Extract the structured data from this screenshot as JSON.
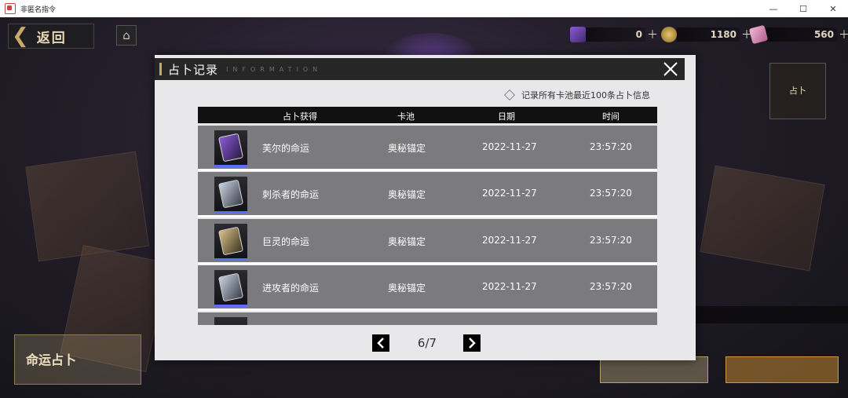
{
  "window": {
    "title": "非匿名指令"
  },
  "topbar": {
    "back_label": "返回",
    "resources": [
      {
        "icon": "purple-gem-icon",
        "value": "0"
      },
      {
        "icon": "gold-coin-icon",
        "value": "1180"
      },
      {
        "icon": "pink-ticket-icon",
        "value": "560"
      }
    ]
  },
  "modal": {
    "title": "占卜记录",
    "subtitle": "INFORMATION",
    "note": "记录所有卡池最近100条占卜信息",
    "columns": [
      "占卜获得",
      "卡池",
      "日期",
      "时间"
    ],
    "rows": [
      {
        "item": "芙尔的命运",
        "pool": "奥秘锚定",
        "date": "2022-11-27",
        "time": "23:57:20",
        "card_color": "#8a5bd6"
      },
      {
        "item": "刺杀者的命运",
        "pool": "奥秘锚定",
        "date": "2022-11-27",
        "time": "23:57:20",
        "card_color": "#9aa5b8"
      },
      {
        "item": "巨灵的命运",
        "pool": "奥秘锚定",
        "date": "2022-11-27",
        "time": "23:57:20",
        "card_color": "#b8a070"
      },
      {
        "item": "进攻者的命运",
        "pool": "奥秘锚定",
        "date": "2022-11-27",
        "time": "23:57:20",
        "card_color": "#9aa5b8"
      }
    ],
    "page": "6/7"
  },
  "background": {
    "left_badge": "命运占卜",
    "side_badge": "占卜"
  }
}
